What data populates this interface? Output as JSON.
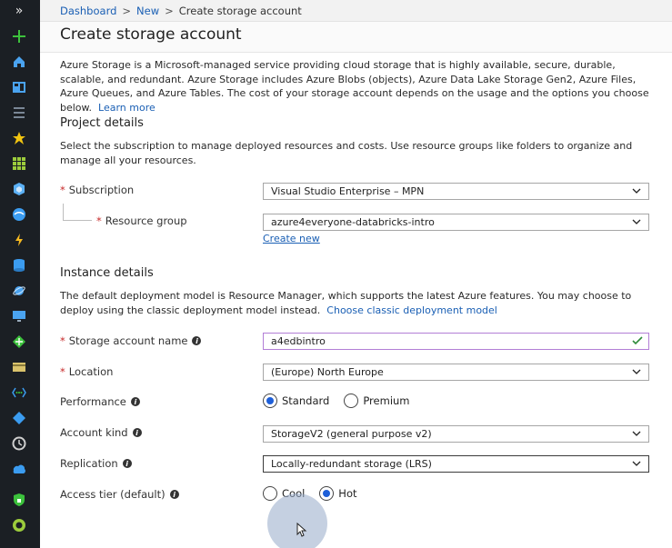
{
  "breadcrumb": {
    "items": [
      {
        "label": "Dashboard"
      },
      {
        "label": "New"
      },
      {
        "label": "Create storage account"
      }
    ]
  },
  "page": {
    "title": "Create storage account"
  },
  "intro": {
    "text": "Azure Storage is a Microsoft-managed service providing cloud storage that is highly available, secure, durable, scalable, and redundant. Azure Storage includes Azure Blobs (objects), Azure Data Lake Storage Gen2, Azure Files, Azure Queues, and Azure Tables. The cost of your storage account depends on the usage and the options you choose below.",
    "link": "Learn more"
  },
  "project": {
    "heading": "Project details",
    "description": "Select the subscription to manage deployed resources and costs. Use resource groups like folders to organize and manage all your resources.",
    "subscription_label": "Subscription",
    "subscription_value": "Visual Studio Enterprise – MPN",
    "resource_group_label": "Resource group",
    "resource_group_value": "azure4everyone-databricks-intro",
    "create_new": "Create new"
  },
  "instance": {
    "heading": "Instance details",
    "description": "The default deployment model is Resource Manager, which supports the latest Azure features. You may choose to deploy using the classic deployment model instead.",
    "classic_link": "Choose classic deployment model",
    "name_label": "Storage account name",
    "name_value": "a4edbintro",
    "location_label": "Location",
    "location_value": "(Europe) North Europe",
    "performance_label": "Performance",
    "performance_options": [
      "Standard",
      "Premium"
    ],
    "performance_selected": "Standard",
    "kind_label": "Account kind",
    "kind_value": "StorageV2 (general purpose v2)",
    "replication_label": "Replication",
    "replication_value": "Locally-redundant storage (LRS)",
    "tier_label": "Access tier (default)",
    "tier_options": [
      "Cool",
      "Hot"
    ],
    "tier_selected": "Hot"
  },
  "rail": {
    "expand_icon": "»",
    "icons": [
      "create-resource-icon",
      "home-icon",
      "dashboard-icon",
      "all-services-icon",
      "favorites-icon",
      "all-resources-icon",
      "resource-groups-icon",
      "app-services-icon",
      "function-apps-icon",
      "sql-databases-icon",
      "cosmos-db-icon",
      "virtual-machines-icon",
      "load-balancers-icon",
      "storage-accounts-icon",
      "virtual-networks-icon",
      "azure-ad-icon",
      "monitor-icon",
      "advisor-icon",
      "security-center-icon",
      "cost-management-icon"
    ]
  },
  "colors": {
    "rail_bg": "#1b1f24",
    "link": "#1a5fb4",
    "required": "#c72a2a",
    "radio_on": "#1e5fd8",
    "valid_check": "#2e8b3a",
    "input_focus": "#b27ed6"
  }
}
